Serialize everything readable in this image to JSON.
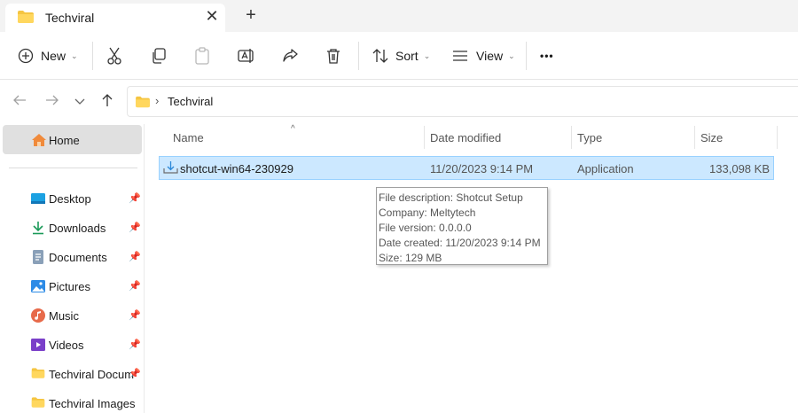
{
  "tab": {
    "title": "Techviral",
    "close": "✕",
    "new_tab": "+"
  },
  "toolbar": {
    "new_label": "New",
    "sort_label": "Sort",
    "view_label": "View",
    "more_label": "•••"
  },
  "address": {
    "separator": "›",
    "crumb": "Techviral"
  },
  "sidebar": {
    "home_label": "Home",
    "items": [
      {
        "label": "Desktop",
        "icon": "desktop-icon",
        "pinned": true
      },
      {
        "label": "Downloads",
        "icon": "download-icon",
        "pinned": true
      },
      {
        "label": "Documents",
        "icon": "documents-icon",
        "pinned": true
      },
      {
        "label": "Pictures",
        "icon": "pictures-icon",
        "pinned": true
      },
      {
        "label": "Music",
        "icon": "music-icon",
        "pinned": true
      },
      {
        "label": "Videos",
        "icon": "videos-icon",
        "pinned": true
      },
      {
        "label": "Techviral Docum",
        "icon": "folder-icon",
        "pinned": true
      },
      {
        "label": "Techviral Images",
        "icon": "folder-icon",
        "pinned": false
      }
    ]
  },
  "columns": {
    "name": "Name",
    "date": "Date modified",
    "type": "Type",
    "size": "Size",
    "sort_caret": "^"
  },
  "file": {
    "name": "shotcut-win64-230929",
    "date": "11/20/2023 9:14 PM",
    "type": "Application",
    "size": "133,098 KB"
  },
  "tooltip": {
    "lines": [
      "File description: Shotcut Setup",
      "Company: Meltytech",
      "File version: 0.0.0.0",
      "Date created: 11/20/2023 9:14 PM",
      "Size: 129 MB"
    ]
  },
  "colors": {
    "selection": "#cce8ff",
    "selection_border": "#99d1ff",
    "folder": "#f5c542",
    "accent": "#0067c0"
  }
}
